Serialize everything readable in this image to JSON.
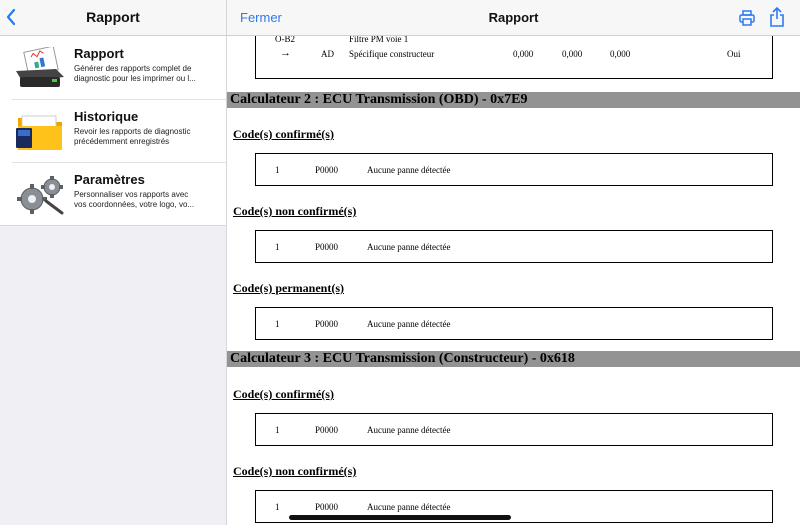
{
  "sidebar": {
    "title": "Rapport",
    "items": [
      {
        "title": "Rapport",
        "desc": "Générer des rapports complet de\ndiagnostic pour les imprimer ou l...",
        "icon": "printer-report-icon"
      },
      {
        "title": "Historique",
        "desc": "Revoir les rapports de diagnostic\nprécédemment enregistrés",
        "icon": "folder-history-icon"
      },
      {
        "title": "Paramètres",
        "desc": "Personnaliser vos rapports avec\nvos coordonnées, votre logo, vo...",
        "icon": "gears-settings-icon"
      }
    ]
  },
  "nav": {
    "close_label": "Fermer",
    "title": "Rapport"
  },
  "report": {
    "prev_row": {
      "code": "O-B2",
      "arrow": "→",
      "type": "AD",
      "name": "Filtre PM voie 1",
      "name2": "Spécifique constructeur",
      "v1": "0,000",
      "v2": "0,000",
      "v3": "0,000",
      "status": "Oui"
    },
    "ecus": [
      {
        "header": "Calculateur 2 : ECU Transmission (OBD) - 0x7E9",
        "sections": [
          {
            "title": "Code(s) confirmé(s)",
            "num": "1",
            "code": "P0000",
            "desc": "Aucune panne détectée"
          },
          {
            "title": "Code(s) non confirmé(s)",
            "num": "1",
            "code": "P0000",
            "desc": "Aucune panne détectée"
          },
          {
            "title": "Code(s) permanent(s)",
            "num": "1",
            "code": "P0000",
            "desc": "Aucune panne détectée"
          }
        ]
      },
      {
        "header": "Calculateur 3 : ECU Transmission (Constructeur) - 0x618",
        "sections": [
          {
            "title": "Code(s) confirmé(s)",
            "num": "1",
            "code": "P0000",
            "desc": "Aucune panne détectée"
          },
          {
            "title": "Code(s) non confirmé(s)",
            "num": "1",
            "code": "P0000",
            "desc": "Aucune panne détectée"
          }
        ]
      }
    ]
  }
}
